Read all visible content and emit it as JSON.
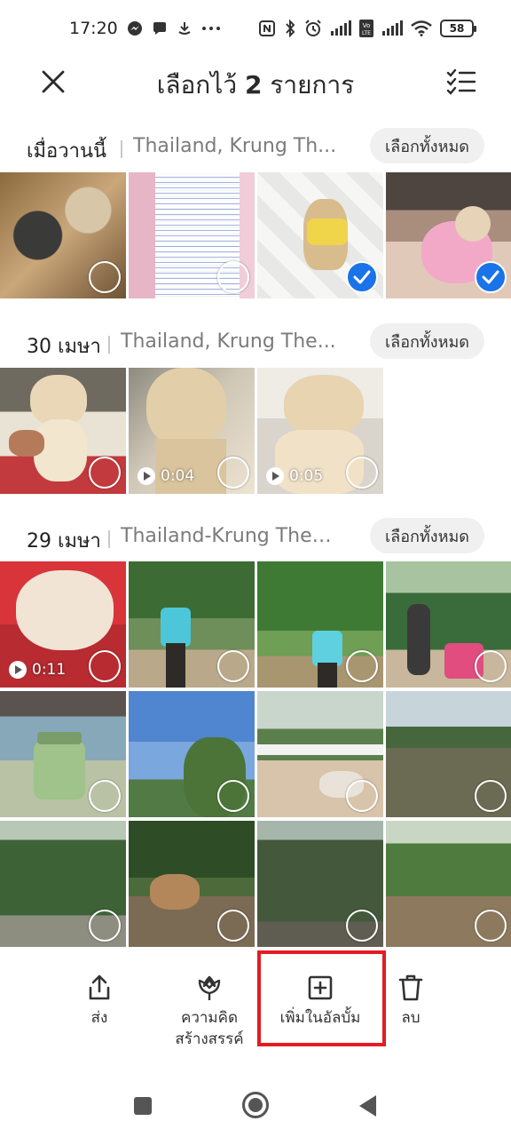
{
  "status_bar": {
    "time": "17:20",
    "notif_icons": [
      "messenger-icon",
      "chat-bubble-icon",
      "download-icon",
      "more-dots-icon"
    ],
    "right_icons": [
      "nfc-icon",
      "bluetooth-icon",
      "alarm-icon",
      "signal-icon",
      "volte-icon",
      "signal-icon",
      "wifi-icon"
    ],
    "battery": "58"
  },
  "header": {
    "title_prefix": "เลือกไว้",
    "title_count": "2",
    "title_suffix": "รายการ"
  },
  "sections": [
    {
      "date": "เมื่อวานนี้",
      "location": "Thailand, Krung Th...",
      "select_all": "เลือกทั้งหมด",
      "items": [
        {
          "desc": "food-bowl",
          "selected": false
        },
        {
          "desc": "document-screenshot",
          "selected": false
        },
        {
          "desc": "dog-yellow-shirt",
          "selected": true
        },
        {
          "desc": "dog-pink-shirt",
          "selected": true
        }
      ]
    },
    {
      "date": "30 เมษา",
      "location": "Thailand, Krung The...",
      "select_all": "เลือกทั้งหมด",
      "items": [
        {
          "desc": "dog-held",
          "selected": false
        },
        {
          "desc": "dog-face-video",
          "duration": "0:04",
          "selected": false
        },
        {
          "desc": "dog-bed-video",
          "duration": "0:05",
          "selected": false
        }
      ]
    },
    {
      "date": "29 เมษา",
      "location": "Thailand-Krung Thep...",
      "select_all": "เลือกทั้งหมด",
      "items": [
        {
          "desc": "dog-belly-video",
          "duration": "0:11",
          "selected": false
        },
        {
          "desc": "woman-park",
          "selected": false
        },
        {
          "desc": "woman-trees",
          "selected": false
        },
        {
          "desc": "person-stroller",
          "selected": false
        },
        {
          "desc": "green-cup",
          "selected": false
        },
        {
          "desc": "tree-sky",
          "selected": false
        },
        {
          "desc": "farm-fence",
          "selected": false
        },
        {
          "desc": "lake",
          "selected": false
        },
        {
          "desc": "forest-path",
          "selected": false
        },
        {
          "desc": "deer",
          "selected": false
        },
        {
          "desc": "pine-trees",
          "selected": false
        },
        {
          "desc": "garden-walkway",
          "selected": false
        }
      ]
    }
  ],
  "actions": {
    "send": "ส่ง",
    "creative_line1": "ความคิด",
    "creative_line2": "สร้างสรรค์",
    "add_album": "เพิ่มในอัลบั้ม",
    "delete": "ลบ"
  },
  "colors": {
    "accent": "#1a73e8",
    "highlight": "#e31b23"
  }
}
